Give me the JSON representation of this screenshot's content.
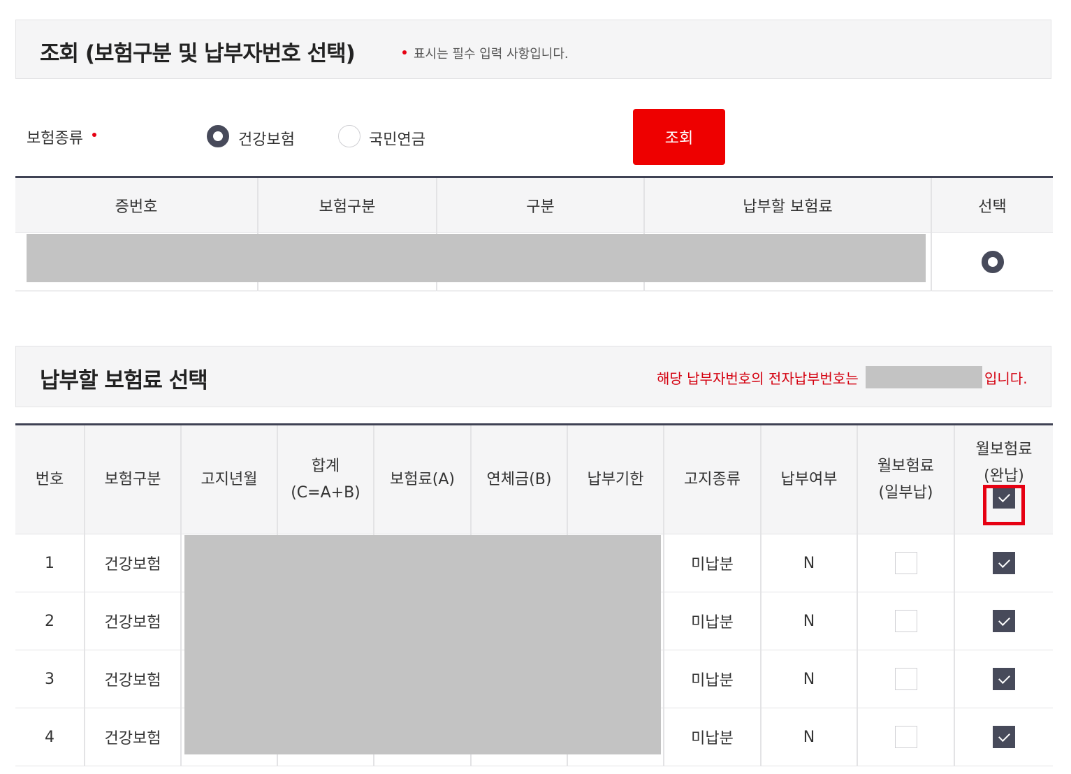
{
  "section1": {
    "title": "조회 (보험구분 및 납부자번호 선택)",
    "required_note": "표시는 필수 입력 사항입니다."
  },
  "search_form": {
    "insurance_type_label": "보험종류",
    "options": [
      {
        "label": "건강보험",
        "selected": true
      },
      {
        "label": "국민연금",
        "selected": false
      }
    ],
    "search_button": "조회"
  },
  "result_table": {
    "headers": [
      "증번호",
      "보험구분",
      "구분",
      "납부할 보험료",
      "선택"
    ],
    "rows": [
      {
        "selected": true
      }
    ]
  },
  "section2": {
    "title": "납부할 보험료 선택",
    "epay_prefix": "해당 납부자번호의 전자납부번호는",
    "epay_suffix": "입니다."
  },
  "premium_table": {
    "headers": {
      "no": "번호",
      "type": "보험구분",
      "notice_month": "고지년월",
      "total_line1": "합계",
      "total_line2": "(C=A+B)",
      "premium": "보험료(A)",
      "late_fee": "연체금(B)",
      "due_date": "납부기한",
      "notice_type": "고지종류",
      "paid": "납부여부",
      "partial_line1": "월보험료",
      "partial_line2": "(일부납)",
      "full_line1": "월보험료",
      "full_line2": "(완납)"
    },
    "select_all_full": true,
    "rows": [
      {
        "no": "1",
        "type": "건강보험",
        "notice_type": "미납분",
        "paid": "N",
        "partial": false,
        "full": true
      },
      {
        "no": "2",
        "type": "건강보험",
        "notice_type": "미납분",
        "paid": "N",
        "partial": false,
        "full": true
      },
      {
        "no": "3",
        "type": "건강보험",
        "notice_type": "미납분",
        "paid": "N",
        "partial": false,
        "full": true
      },
      {
        "no": "4",
        "type": "건강보험",
        "notice_type": "미납분",
        "paid": "N",
        "partial": false,
        "full": true
      }
    ]
  },
  "colors": {
    "accent_red": "#ee0000",
    "dark_slate": "#474a5a",
    "redaction_gray": "#c3c3c3"
  }
}
